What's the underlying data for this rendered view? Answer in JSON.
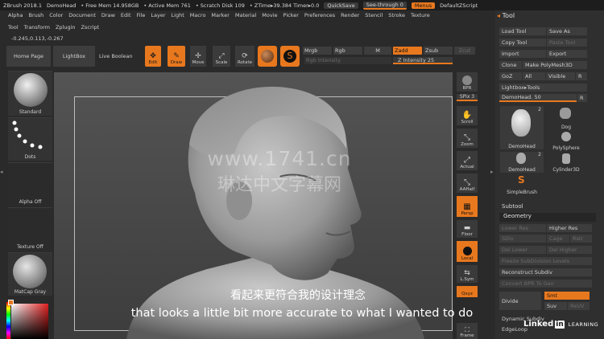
{
  "titlebar": {
    "app": "ZBrush 2018.1",
    "doc": "DemoHead",
    "free_mem": "• Free Mem 14.958GB",
    "active_mem": "• Active Mem 761",
    "scratch": "• Scratch Disk 109",
    "ztime": "• ZTime▸39.384 Timer▸0.0",
    "quicksave": "QuickSave",
    "seethrough": "See-through  0",
    "menus": "Menus",
    "script": "DefaultZScript"
  },
  "menu_row1": [
    "Alpha",
    "Brush",
    "Color",
    "Document",
    "Draw",
    "Edit",
    "File",
    "Layer",
    "Light",
    "Macro",
    "Marker",
    "Material",
    "Movie",
    "Picker",
    "Preferences",
    "Render",
    "Stencil",
    "Stroke",
    "Texture"
  ],
  "menu_row2": [
    "Tool",
    "Transform",
    "Zplugin",
    "Zscript"
  ],
  "coords": "-0.245,0.113,-0.267",
  "toolbar": {
    "home": "Home Page",
    "lightbox": "LightBox",
    "live_boolean": "Live Boolean",
    "edit": "Edit",
    "draw": "Draw",
    "move": "Move",
    "scale": "Scale",
    "rotate": "Rotate",
    "mrgb": "Mrgb",
    "rgb": "Rgb",
    "m": "M",
    "zadd": "Zadd",
    "zsub": "Zsub",
    "zcut": "Zcut",
    "rgb_intensity": "Rgb Intensity",
    "z_intensity": "Z Intensity 25"
  },
  "left_shelf": {
    "standard": "Standard",
    "dots": "Dots",
    "alpha": "Alpha Off",
    "texture": "Texture Off",
    "matcap": "MatCap Gray"
  },
  "right_shelf": {
    "bpr": "BPR",
    "spix": "SPix 3",
    "scroll": "Scroll",
    "zoom": "Zoom",
    "actual": "Actual",
    "aahalf": "AAHalf",
    "persp": "Persp",
    "floor": "Floor",
    "local": "Local",
    "lsym": "L.Sym",
    "xyz": "Qxyz",
    "frame": "Frame"
  },
  "tool_panel": {
    "title": "Tool",
    "load": "Load Tool",
    "save_as": "Save As",
    "copy": "Copy Tool",
    "paste": "Paste Tool",
    "import": "Import",
    "export": "Export",
    "clone": "Clone",
    "make_polymesh": "Make PolyMesh3D",
    "goz": "GoZ",
    "all": "All",
    "visible": "Visible",
    "r": "R",
    "lightbox_tools": "Lightbox▸Tools",
    "demohead_slider": "DemoHead. 50",
    "r2": "R",
    "thumb_demohead": "DemoHead",
    "thumb_count1": "2",
    "thumb_dog": "Dog",
    "thumb_polysphere": "PolySphere",
    "thumb_demohead2": "DemoHead",
    "thumb_count2": "2",
    "thumb_cylinder": "Cylinder3D",
    "thumb_simplebrush": "SimpleBrush",
    "subtool": "Subtool",
    "geometry": "Geometry",
    "lower_res": "Lower Res",
    "higher_res": "Higher Res",
    "sdiv": "SDiv",
    "cage": "Cage",
    "rstr": "Rstr",
    "del_lower": "Del Lower",
    "del_higher": "Del Higher",
    "freeze": "Freeze SubDivision Levels",
    "reconstruct": "Reconstruct Subdiv",
    "convert_bpr": "Convert BPR To Geo",
    "divide": "Divide",
    "smt": "Smt",
    "suv": "Suv",
    "reuv": "ReUV",
    "dynamic_subdiv": "Dynamic Subdiv",
    "edgeloop": "EdgeLoop"
  },
  "watermark": {
    "url": "www.1741.cn",
    "cn": "琳达中文字幕网"
  },
  "subtitles": {
    "cn": "看起来更符合我的设计理念",
    "en": "that looks a little bit more accurate to what I wanted to do"
  },
  "branding": {
    "linked": "Linked",
    "in": "in",
    "learning": "LEARNING"
  },
  "colors": {
    "accent": "#e8781e",
    "panel": "#2f2f2f",
    "subtitle_cn": "#ffffff",
    "subtitle_en": "#ffffff"
  }
}
